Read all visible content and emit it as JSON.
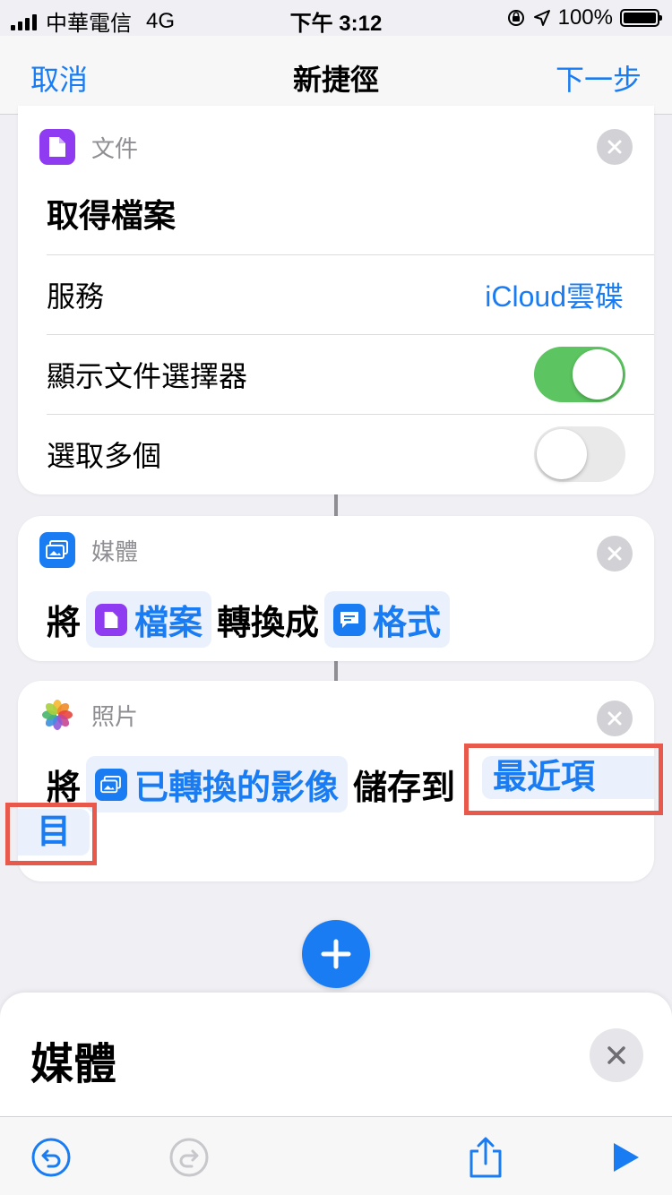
{
  "status_bar": {
    "carrier": "中華電信",
    "network": "4G",
    "time": "下午 3:12",
    "battery": "100%",
    "icons": [
      "signal-icon",
      "rotation-lock-icon",
      "location-icon",
      "battery-icon"
    ]
  },
  "nav": {
    "cancel": "取消",
    "title": "新捷徑",
    "next": "下一步"
  },
  "card1": {
    "category": "文件",
    "title": "取得檔案",
    "rows": [
      {
        "label": "服務",
        "value": "iCloud雲碟"
      },
      {
        "label": "顯示文件選擇器",
        "toggle": true
      },
      {
        "label": "選取多個",
        "toggle": false
      }
    ]
  },
  "card2": {
    "category": "媒體",
    "prefix": "將",
    "token1": "檔案",
    "middle": "轉換成",
    "token2": "格式"
  },
  "card3": {
    "category": "照片",
    "prefix": "將",
    "token1": "已轉換的影像",
    "middle": "儲存到",
    "token2_part1": "最近項",
    "token2_part2": "目"
  },
  "sheet": {
    "title": "媒體"
  },
  "colors": {
    "accent": "#1a7cf2",
    "toggle_on": "#5cc460",
    "highlight": "#e8584b",
    "files_purple": "#8e3bf1"
  }
}
